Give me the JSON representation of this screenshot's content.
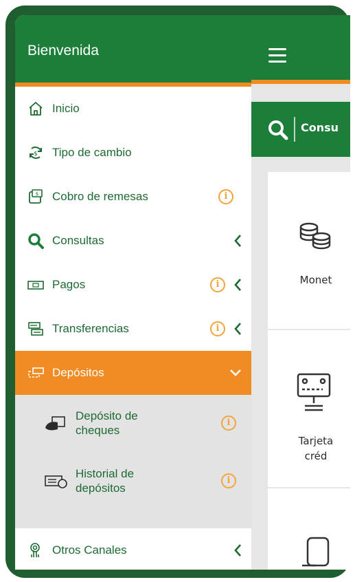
{
  "drawer": {
    "title": "Bienvenida",
    "items": [
      {
        "label": "Inicio",
        "icon": "home-icon"
      },
      {
        "label": "Tipo de cambio",
        "icon": "exchange-icon"
      },
      {
        "label": "Cobro de remesas",
        "icon": "remittance-icon",
        "info": "i"
      },
      {
        "label": "Consultas",
        "icon": "search-icon"
      },
      {
        "label": "Pagos",
        "icon": "payment-icon",
        "info": "i"
      },
      {
        "label": "Transferencias",
        "icon": "transfer-icon",
        "info": "i"
      },
      {
        "label": "Depósitos",
        "icon": "deposit-icon",
        "expanded": true
      },
      {
        "label": "Otros Canales",
        "icon": "channels-icon"
      }
    ],
    "deposit_sub": [
      {
        "label_line1": "Depósito de",
        "label_line2": "cheques",
        "icon": "cheque-icon",
        "info": "i"
      },
      {
        "label_line1": "Historial de",
        "label_line2": "depósitos",
        "icon": "history-icon",
        "info": "i"
      }
    ]
  },
  "main": {
    "search_text": "Consu",
    "cards": [
      {
        "label": "Monet"
      },
      {
        "label_line1": "Tarjeta",
        "label_line2": "créd"
      }
    ]
  },
  "colors": {
    "brand_green": "#1d7e3a",
    "accent_orange": "#f18c25",
    "frame_green": "#1e5e2f"
  }
}
